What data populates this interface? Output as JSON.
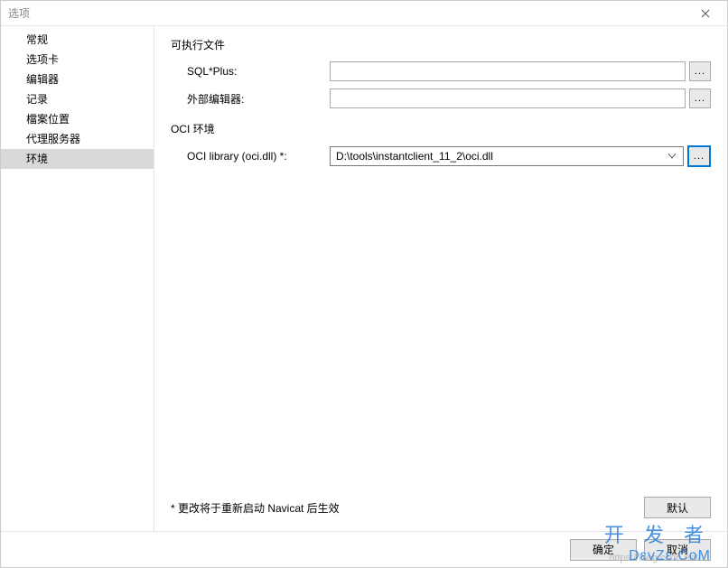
{
  "window": {
    "title": "选项"
  },
  "sidebar": {
    "items": [
      {
        "label": "常规"
      },
      {
        "label": "选项卡"
      },
      {
        "label": "编辑器"
      },
      {
        "label": "记录"
      },
      {
        "label": "檔案位置"
      },
      {
        "label": "代理服务器"
      },
      {
        "label": "环境"
      }
    ],
    "selected_index": 6
  },
  "sections": {
    "executable": {
      "title": "可执行文件",
      "sqlplus_label": "SQL*Plus:",
      "sqlplus_value": "",
      "external_editor_label": "外部编辑器:",
      "external_editor_value": ""
    },
    "oci": {
      "title": "OCI 环境",
      "library_label": "OCI library (oci.dll) *:",
      "library_value": "D:\\tools\\instantclient_11_2\\oci.dll"
    }
  },
  "browse_label": "...",
  "footer_note": "* 更改将于重新启动 Navicat 后生效",
  "buttons": {
    "default": "默认",
    "ok": "确定",
    "cancel": "取消"
  },
  "watermark": {
    "line1": "开 发 者",
    "line2": "DεvZε.CoM",
    "url": "https://blog.csdn.net/..."
  }
}
